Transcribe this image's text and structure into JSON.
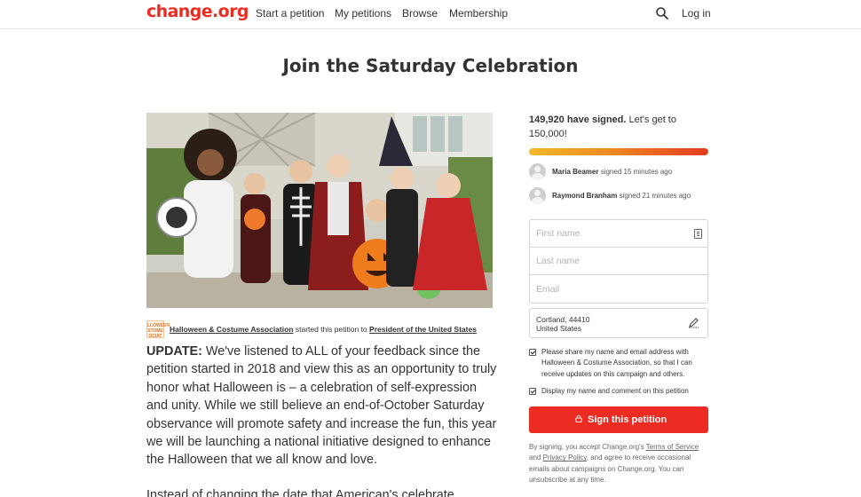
{
  "header": {
    "logo": "change.org",
    "nav": [
      "Start a petition",
      "My petitions",
      "Browse",
      "Membership"
    ],
    "login": "Log in",
    "search_icon": "search-icon"
  },
  "petition": {
    "title": "Join the Saturday Celebration",
    "image_alt": "Children in Halloween costumes",
    "starter": {
      "logo_text": "LLOWEEN STUME OCIAT",
      "organization": "Halloween & Costume Association",
      "middle": " started this petition to ",
      "target": "President of the United States"
    },
    "update_label": "UPDATE:",
    "update_body": " We've listened to ALL of your feedback since the petition started in 2018 and view this as an opportunity to truly honor what Halloween is – a celebration of self-expression and unity. While we still believe an end-of-October Saturday observance will promote safety and increase the fun, this year we will be launching a national initiative designed to enhance the Halloween that we all know and love.",
    "next_paragraph": "Instead of changing the date that American's celebrate"
  },
  "sidebar": {
    "signed_count": "149,920 have signed.",
    "goal_text": " Let's get to 150,000!",
    "progress_fraction": 0.9995,
    "recent_signers": [
      {
        "name": "Maria Beamer",
        "when": " signed 15 minutes ago"
      },
      {
        "name": "Raymond Branham",
        "when": " signed 21 minutes ago"
      }
    ],
    "form": {
      "first_name_placeholder": "First name",
      "last_name_placeholder": "Last name",
      "email_placeholder": "Email",
      "location_line1": "Cortland, 44410",
      "location_line2": "United States"
    },
    "checkbox_share": "Please share my name and email address with Halloween & Costume Association, so that I can receive updates on this campaign and others.",
    "checkbox_display": "Display my name and comment on this petition",
    "sign_button": "Sign this petition",
    "legal": {
      "before": "By signing, you accept Change.org's ",
      "terms": "Terms of Service",
      "and": " and ",
      "privacy": "Privacy Policy",
      "after": ", and agree to receive occasional emails about campaigns on Change.org. You can unsubscribe at any time."
    }
  },
  "colors": {
    "brand": "#ec2c22",
    "progress_start": "#f4b72a",
    "progress_end": "#e23b1e"
  }
}
